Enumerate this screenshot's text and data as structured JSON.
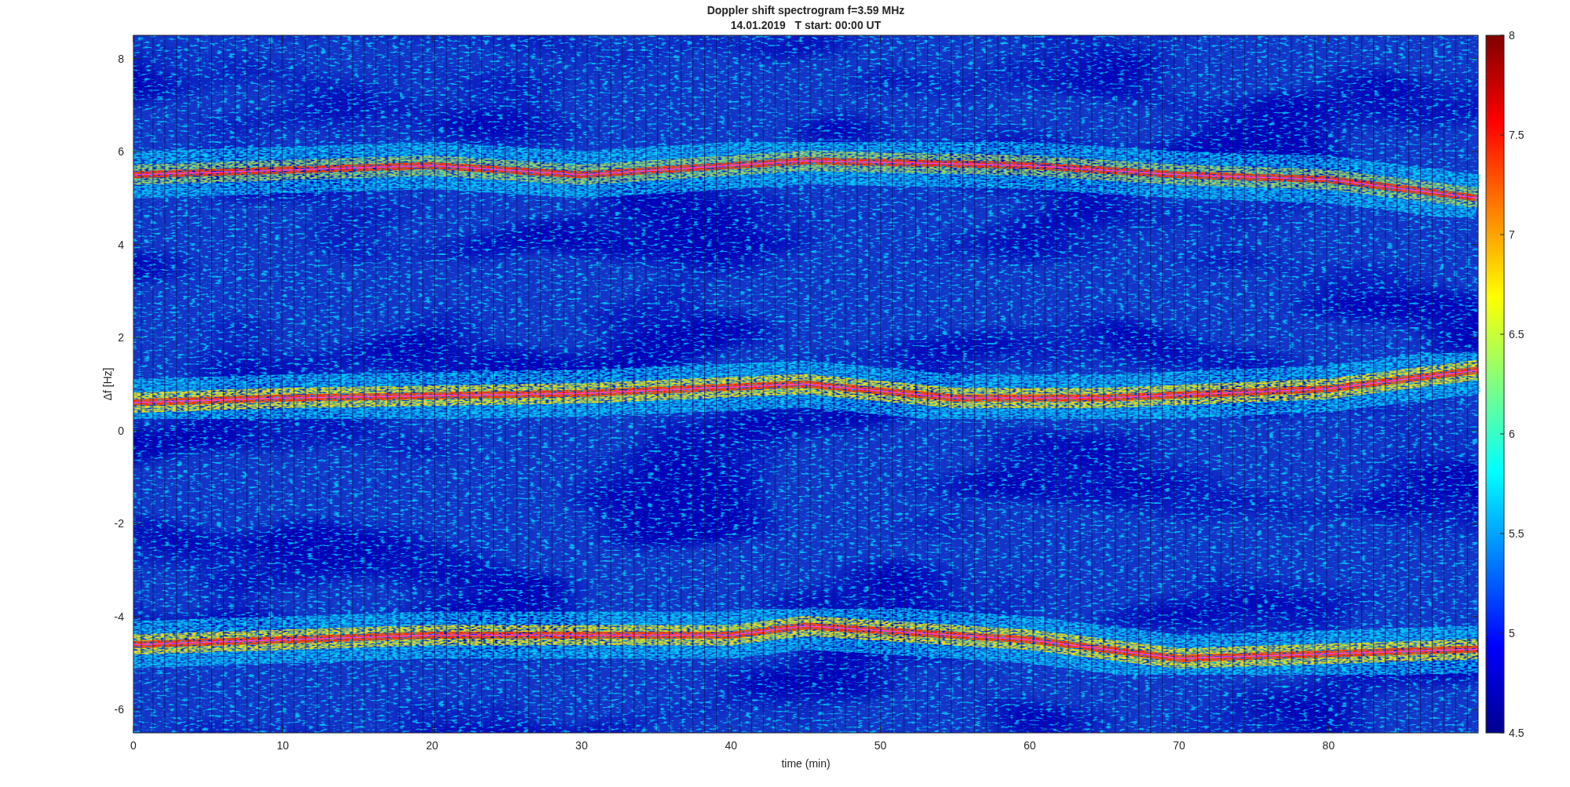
{
  "figure": {
    "title": "Doppler shift spectrogram f=3.59 MHz",
    "subtitle": "14.01.2019   T start: 00:00 UT",
    "xlabel": "time (min)",
    "ylabel": "Δf [Hz]",
    "x_ticks": [
      "0",
      "10",
      "20",
      "30",
      "40",
      "50",
      "60",
      "70",
      "80"
    ],
    "y_ticks": [
      "8",
      "6",
      "4",
      "2",
      "0",
      "-2",
      "-4",
      "-6"
    ],
    "colorbar_ticks": [
      "8",
      "7.5",
      "7",
      "6.5",
      "6",
      "5.5",
      "5",
      "4.5"
    ]
  }
}
